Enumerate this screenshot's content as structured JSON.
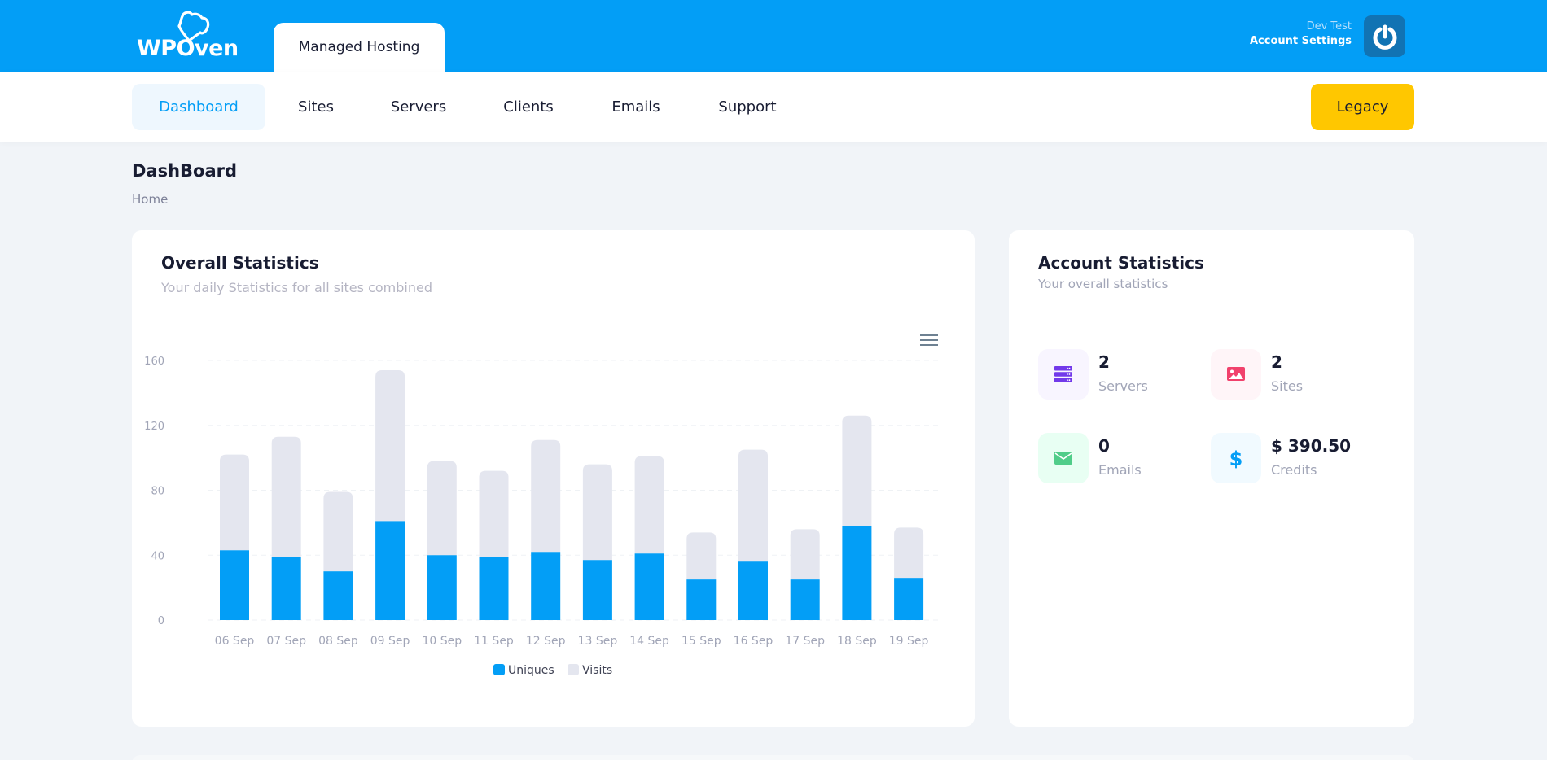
{
  "header": {
    "brand": "WPOven",
    "product_tab": "Managed Hosting",
    "user_name": "Dev Test",
    "account_settings": "Account Settings",
    "brand_color": "#039ef6"
  },
  "nav": {
    "items": [
      {
        "label": "Dashboard",
        "active": true
      },
      {
        "label": "Sites",
        "active": false
      },
      {
        "label": "Servers",
        "active": false
      },
      {
        "label": "Clients",
        "active": false
      },
      {
        "label": "Emails",
        "active": false
      },
      {
        "label": "Support",
        "active": false
      }
    ],
    "legacy_button": "Legacy"
  },
  "page": {
    "title": "DashBoard",
    "breadcrumb": "Home"
  },
  "overall": {
    "title": "Overall Statistics",
    "subtitle": "Your daily Statistics for all sites combined"
  },
  "account": {
    "title": "Account Statistics",
    "subtitle": "Your overall statistics",
    "stats": [
      {
        "value": "2",
        "label": "Servers",
        "icon": "server-icon",
        "color": "#7239ea",
        "bg": "#f8f5ff"
      },
      {
        "value": "2",
        "label": "Sites",
        "icon": "image-icon",
        "color": "#f1416c",
        "bg": "#fff5f8"
      },
      {
        "value": "0",
        "label": "Emails",
        "icon": "envelope-icon",
        "color": "#50cd89",
        "bg": "#e8fff3"
      },
      {
        "value": "$ 390.50",
        "label": "Credits",
        "icon": "dollar-icon",
        "color": "#039ef6",
        "bg": "#f1faff"
      }
    ]
  },
  "chart_data": {
    "type": "bar",
    "stacked": true,
    "title": "Overall Statistics",
    "xlabel": "",
    "ylabel": "",
    "categories": [
      "06 Sep",
      "07 Sep",
      "08 Sep",
      "09 Sep",
      "10 Sep",
      "11 Sep",
      "12 Sep",
      "13 Sep",
      "14 Sep",
      "15 Sep",
      "16 Sep",
      "17 Sep",
      "18 Sep",
      "19 Sep"
    ],
    "series": [
      {
        "name": "Uniques",
        "color": "#039ef6",
        "values": [
          43,
          39,
          30,
          61,
          40,
          39,
          42,
          37,
          41,
          25,
          36,
          25,
          58,
          26
        ]
      },
      {
        "name": "Visits",
        "color": "#e4e6ef",
        "values": [
          59,
          74,
          49,
          93,
          58,
          53,
          69,
          59,
          60,
          29,
          69,
          31,
          68,
          31
        ]
      }
    ],
    "ylim": [
      0,
      160
    ],
    "yticks": [
      0,
      40,
      80,
      120,
      160
    ],
    "grid": true,
    "legend": "bottom-center"
  }
}
